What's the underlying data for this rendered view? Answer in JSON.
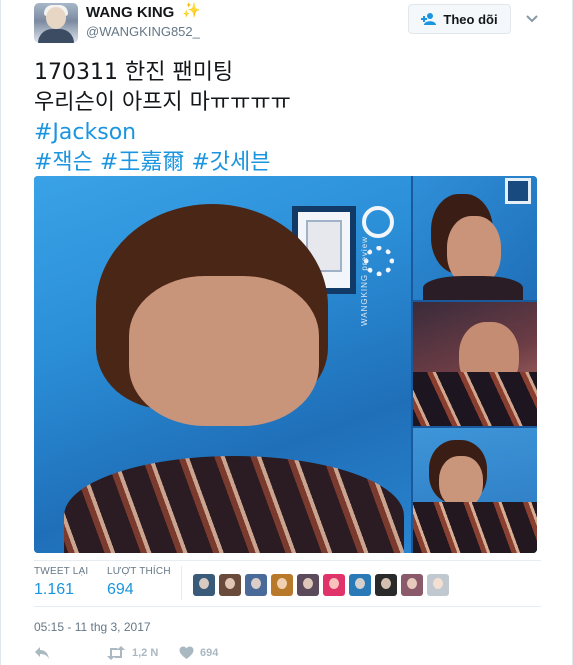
{
  "author": {
    "display_name": "WANG KING",
    "handle": "@WANGKING852_",
    "name_emoji": "✨"
  },
  "follow_button": {
    "label": "Theo dõi",
    "icon": "add-user-icon"
  },
  "menu_icon": "chevron-down-icon",
  "tweet": {
    "line1": "170311 한진 팬미팅",
    "line2": "우리슨이 아프지 마ㅠㅠㅠㅠ",
    "hashtag1": "#Jackson",
    "hashtags_line": [
      "#잭슨",
      "#王嘉爾",
      "#갓세븐"
    ]
  },
  "media": {
    "watermark": "WANGKING preview"
  },
  "stats": {
    "retweets_label": "TWEET LẠI",
    "retweets_value": "1.161",
    "likes_label": "LƯỢT THÍCH",
    "likes_value": "694"
  },
  "likers": [
    {
      "name": "liker-1",
      "color": "#3a5a7a"
    },
    {
      "name": "liker-2",
      "color": "#6a4a3a"
    },
    {
      "name": "liker-3",
      "color": "#4a6a9a"
    },
    {
      "name": "liker-4",
      "color": "#b87a2a"
    },
    {
      "name": "liker-5",
      "color": "#5a4a5a"
    },
    {
      "name": "liker-6",
      "color": "#e0336a"
    },
    {
      "name": "liker-7",
      "color": "#2a7ab8"
    },
    {
      "name": "liker-8",
      "color": "#2a2a2a"
    },
    {
      "name": "liker-9",
      "color": "#8a5a6a"
    },
    {
      "name": "liker-10",
      "color": "#c0c8d0"
    }
  ],
  "timestamp": "05:15 - 11 thg 3, 2017",
  "actions": {
    "reply_icon": "reply-icon",
    "retweet_icon": "retweet-icon",
    "retweet_count": "1,2 N",
    "like_icon": "heart-icon",
    "like_count": "694"
  },
  "colors": {
    "link": "#1b95e0",
    "muted": "#657786",
    "action_gray": "#aab8c2"
  }
}
